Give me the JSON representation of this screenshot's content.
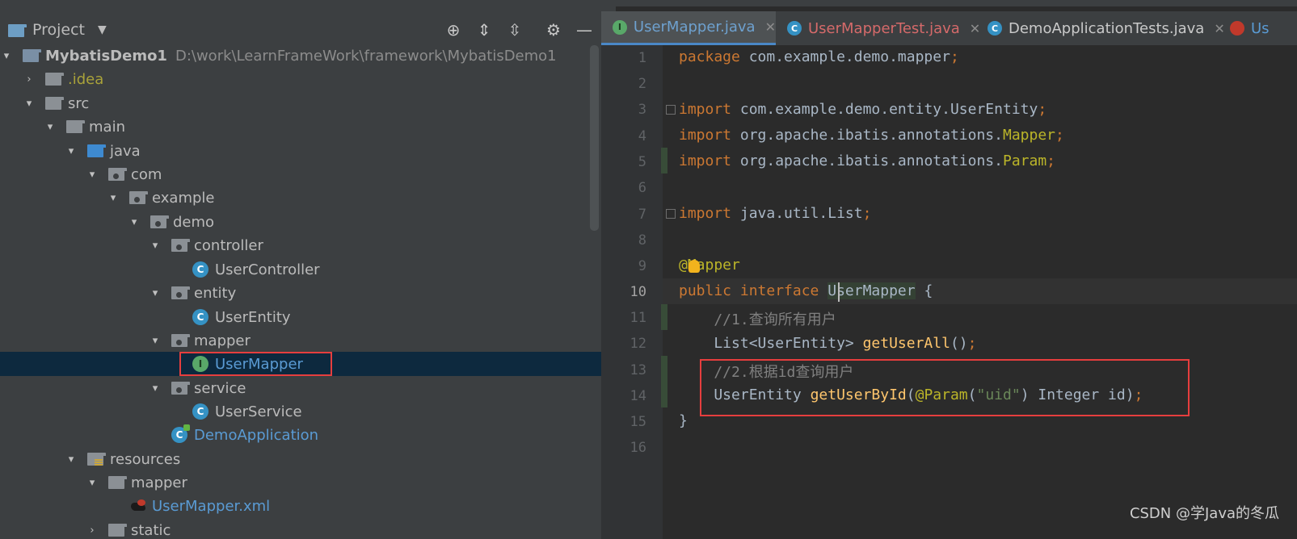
{
  "project_panel": {
    "title": "Project",
    "toolbar_icons": [
      "locate-icon",
      "expand-all-icon",
      "collapse-all-icon",
      "gear-icon",
      "minimize-icon"
    ],
    "tree": [
      {
        "label": "MybatisDemo1",
        "path": "D:\\work\\LearnFrameWork\\framework\\MybatisDemo1"
      },
      {
        "label": ".idea"
      },
      {
        "label": "src"
      },
      {
        "label": "main"
      },
      {
        "label": "java"
      },
      {
        "label": "com"
      },
      {
        "label": "example"
      },
      {
        "label": "demo"
      },
      {
        "label": "controller"
      },
      {
        "label": "UserController"
      },
      {
        "label": "entity"
      },
      {
        "label": "UserEntity"
      },
      {
        "label": "mapper"
      },
      {
        "label": "UserMapper"
      },
      {
        "label": "service"
      },
      {
        "label": "UserService"
      },
      {
        "label": "DemoApplication"
      },
      {
        "label": "resources"
      },
      {
        "label": "mapper"
      },
      {
        "label": "UserMapper.xml"
      },
      {
        "label": "static"
      }
    ]
  },
  "editor_tabs": [
    {
      "label": "UserMapper.java",
      "icon": "I"
    },
    {
      "label": "UserMapperTest.java",
      "icon": "C"
    },
    {
      "label": "DemoApplicationTests.java",
      "icon": "C"
    },
    {
      "label": "Us",
      "icon": "xml"
    }
  ],
  "code": {
    "line_numbers": [
      "1",
      "2",
      "3",
      "4",
      "5",
      "6",
      "7",
      "8",
      "9",
      "10",
      "11",
      "12",
      "13",
      "14",
      "15",
      "16"
    ],
    "lines": {
      "l1_kw": "package",
      "l1_rest": " com.example.demo.mapper",
      "l3_kw": "import",
      "l3_rest": " com.example.demo.entity.UserEntity",
      "l4_kw": "import",
      "l4_rest": " org.apache.ibatis.annotations.",
      "l4_ann": "Mapper",
      "l5_kw": "import",
      "l5_rest": " org.apache.ibatis.annotations.",
      "l5_ann": "Param",
      "l7_kw": "import",
      "l7_rest": " java.util.List",
      "l9_ann": "@Mapper",
      "l10_kw": "public interface ",
      "l10_ident": "UserMapper",
      "l10_rest": " {",
      "l11_cmt": "    //1.查询所有用户",
      "l12_type": "    List<UserEntity> ",
      "l12_mth": "getUserAll",
      "l12_rest": "()",
      "l13_cmt": "    //2.根据id查询用户",
      "l14_type": "    UserEntity ",
      "l14_mth": "getUserById",
      "l14_p1": "(",
      "l14_ann": "@Param",
      "l14_p2": "(",
      "l14_str": "\"uid\"",
      "l14_p3": ") Integer id)",
      "l15": "}",
      "semicolon": ";"
    }
  },
  "watermark": "CSDN @学Java的冬瓜"
}
